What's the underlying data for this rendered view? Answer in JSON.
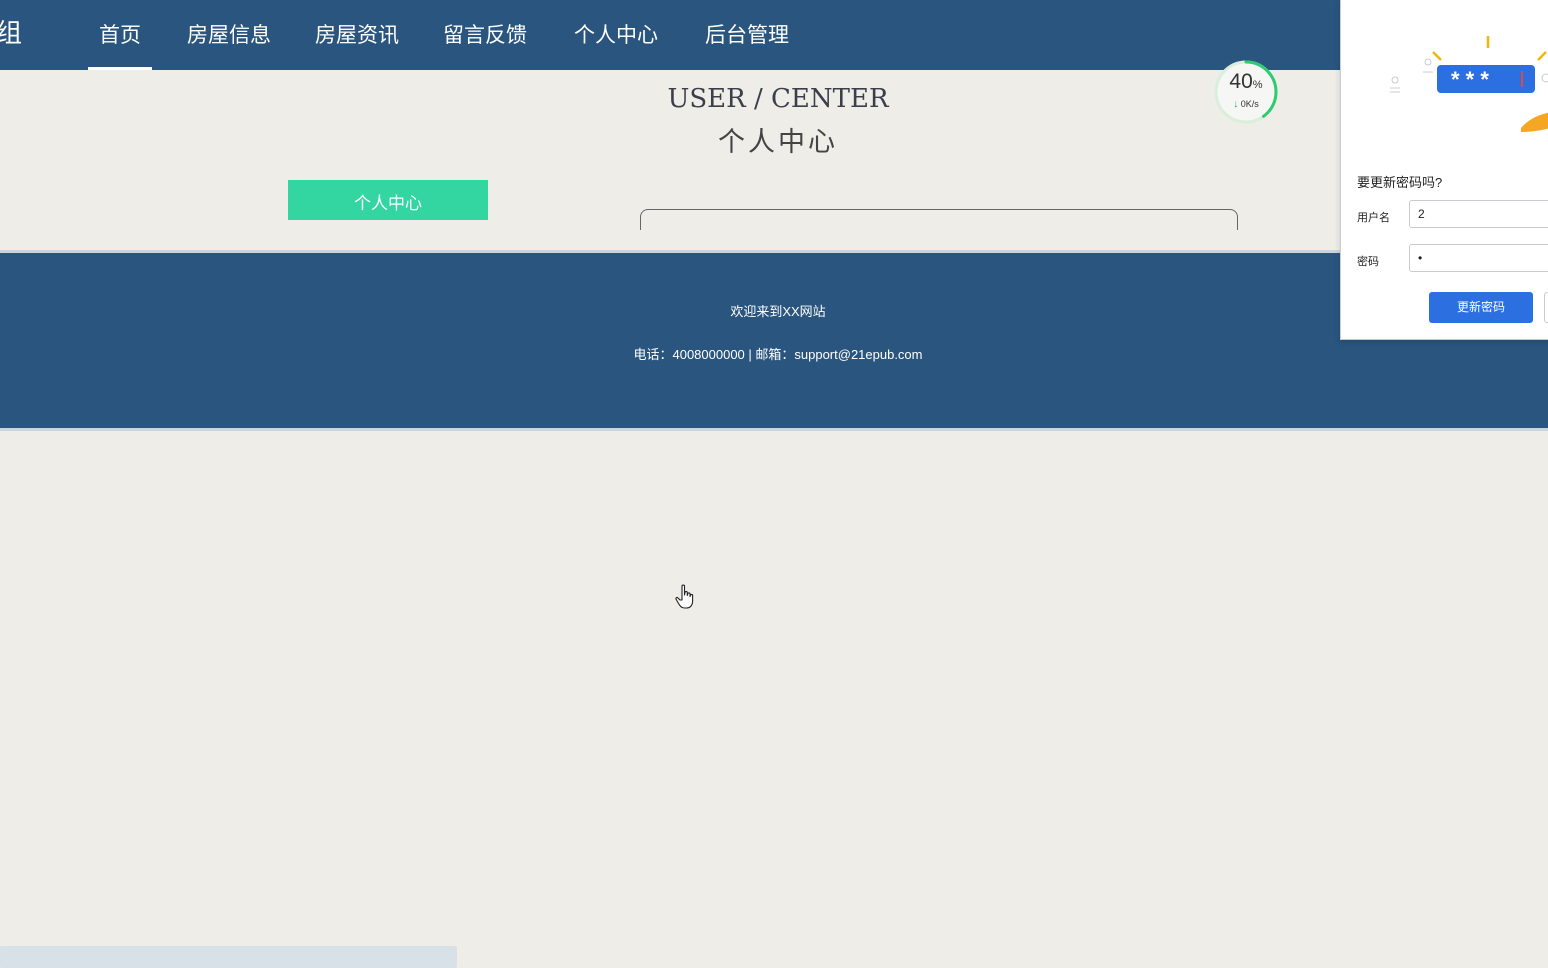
{
  "nav": {
    "brand": "组",
    "items": [
      {
        "label": "首页",
        "active": true
      },
      {
        "label": "房屋信息"
      },
      {
        "label": "房屋资讯"
      },
      {
        "label": "留言反馈"
      },
      {
        "label": "个人中心"
      },
      {
        "label": "后台管理"
      }
    ]
  },
  "header": {
    "title_en": "USER / CENTER",
    "title_cn": "个人中心"
  },
  "sidebar": {
    "button_label": "个人中心"
  },
  "speed_widget": {
    "percent": "40",
    "percent_unit": "%",
    "rate": "0K/s",
    "progress": 0.4
  },
  "footer": {
    "welcome": "欢迎来到XX网站",
    "contact": "电话：4008000000 | 邮箱：support@21epub.com"
  },
  "password_popup": {
    "question": "要更新密码吗?",
    "username_label": "用户名",
    "username_value": "2",
    "password_label": "密码",
    "password_value": "•",
    "illustration_text": "* * *",
    "update_button": "更新密码"
  },
  "colors": {
    "nav_bg": "#29557e",
    "page_bg": "#eeede8",
    "accent_green": "#33d6a0",
    "popup_button": "#2b6fe0"
  }
}
